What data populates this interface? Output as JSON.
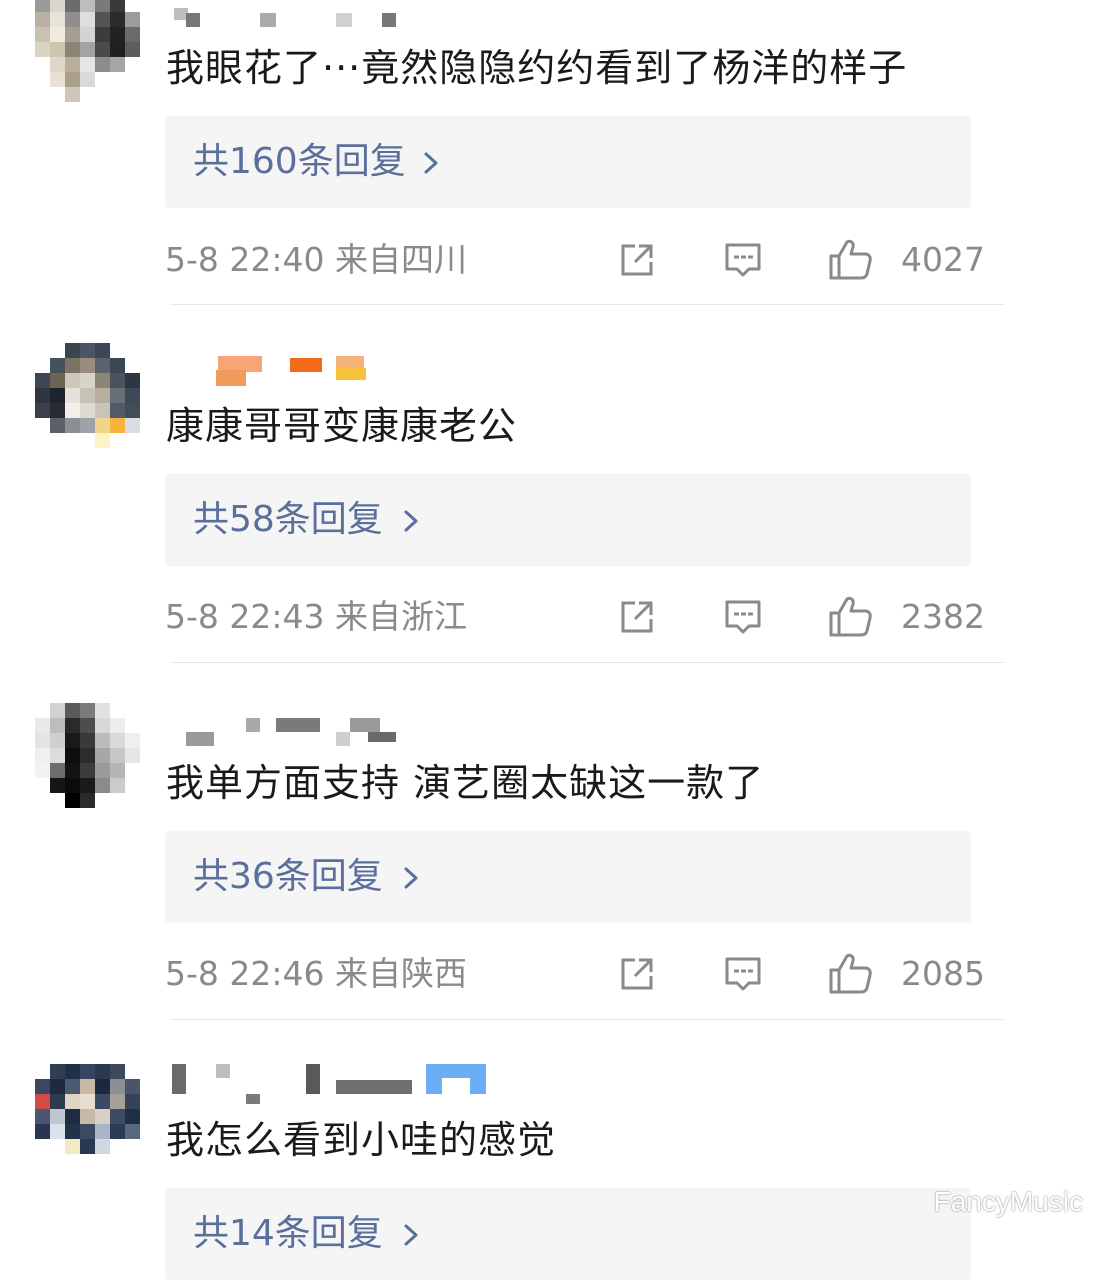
{
  "comments": [
    {
      "text": "我眼花了···竟然隐隐约约看到了杨洋的样子",
      "replies_label": "共160条回复",
      "time_location": "5-8 22:40  来自四川",
      "likes": "4027"
    },
    {
      "text": "康康哥哥变康康老公",
      "replies_label": "共58条回复",
      "time_location": "5-8 22:43  来自浙江",
      "likes": "2382"
    },
    {
      "text": "我单方面支持 演艺圈太缺这一款了",
      "replies_label": "共36条回复",
      "time_location": "5-8 22:46  来自陕西",
      "likes": "2085"
    },
    {
      "text": "我怎么看到小哇的感觉",
      "replies_label": "共14条回复",
      "time_location": "",
      "likes": ""
    }
  ],
  "watermark": "FancyMusic",
  "colors": {
    "reply_link": "#5a6f9b",
    "meta_text": "#8a8a8a",
    "reply_box": "#f5f5f5"
  },
  "icons": [
    "share-icon",
    "comment-icon",
    "like-icon",
    "chevron-right-icon"
  ]
}
